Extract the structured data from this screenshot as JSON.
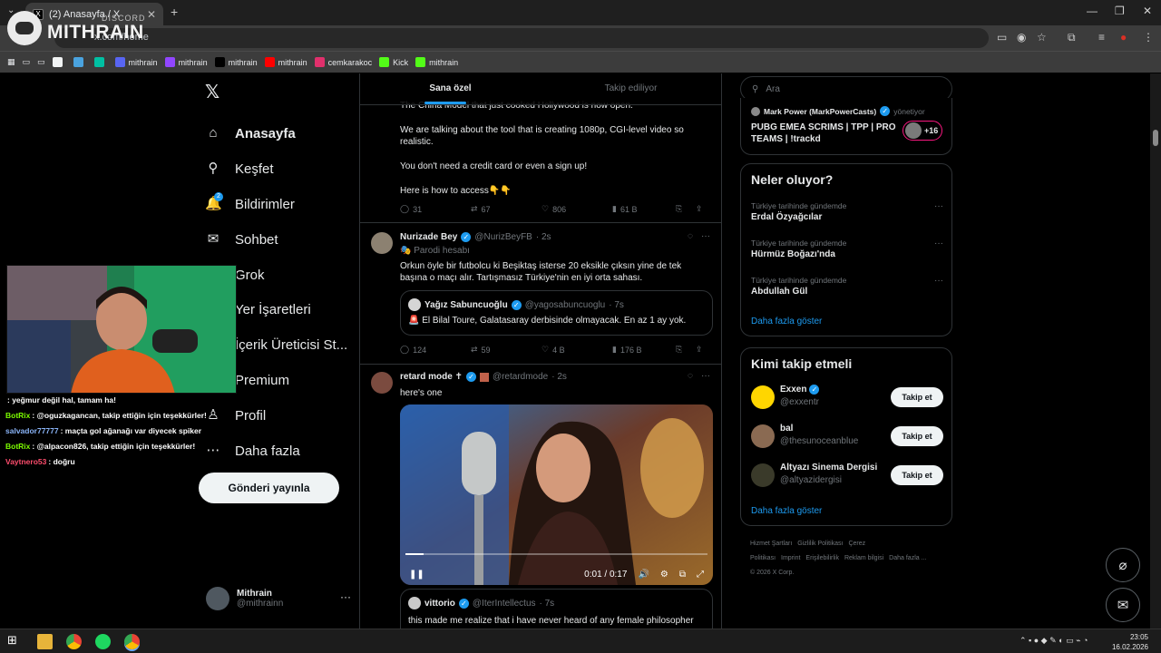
{
  "browser": {
    "tab_title": "(2) Anasayfa / X",
    "tab_close": "✕",
    "new_tab": "+",
    "url": "x.com/home"
  },
  "bookmarks": [
    {
      "label": "",
      "color": "#f1f3f4"
    },
    {
      "label": "",
      "color": "#4aa3df"
    },
    {
      "label": "",
      "color": "#00c0a3"
    },
    {
      "label": "mithrain",
      "color": "#5865f2"
    },
    {
      "label": "mithrain",
      "color": "#9146ff"
    },
    {
      "label": "mithrain",
      "color": "#000000"
    },
    {
      "label": "mithrain",
      "color": "#ff0000"
    },
    {
      "label": "cemkarakoc",
      "color": "#e1306c"
    },
    {
      "label": "Kick",
      "color": "#53fc18"
    },
    {
      "label": "mithrain",
      "color": "#53fc18"
    }
  ],
  "discord": {
    "small": "DISCORD",
    "big": "MITHRAIN"
  },
  "nav": {
    "items": [
      {
        "label": "Anasayfa",
        "icon": "home-icon",
        "glyph": "⌂"
      },
      {
        "label": "Keşfet",
        "icon": "search-icon",
        "glyph": "⚲"
      },
      {
        "label": "Bildirimler",
        "icon": "bell-icon",
        "glyph": "🔔"
      },
      {
        "label": "Sohbet",
        "icon": "mail-icon",
        "glyph": "✉"
      },
      {
        "label": "Grok",
        "icon": "grok-icon",
        "glyph": "◌"
      },
      {
        "label": "Yer İşaretleri",
        "icon": "bookmark-icon",
        "glyph": "☐"
      },
      {
        "label": "İçerik Üreticisi St...",
        "icon": "creator-icon",
        "glyph": "⚡"
      },
      {
        "label": "Premium",
        "icon": "premium-icon",
        "glyph": "✕"
      },
      {
        "label": "Profil",
        "icon": "profile-icon",
        "glyph": "♙"
      },
      {
        "label": "Daha fazla",
        "icon": "more-icon",
        "glyph": "⋯"
      }
    ],
    "notif_count": "2",
    "post_button": "Gönderi yayınla",
    "account_name": "Mithrain",
    "account_handle": "@mithrainn"
  },
  "chat": [
    {
      "user": "",
      "msg": ": yeğmur değil hal, tamam ha!",
      "color": "#ff5f9e"
    },
    {
      "user": "BotRix",
      "msg": ": @oguzkagancan, takip ettiğin için teşekkürler!",
      "color": "#7cfc00"
    },
    {
      "user": "salvador77777",
      "msg": ": maçta gol ağanağı var diyecek spiker",
      "color": "#8ab4f8"
    },
    {
      "user": "BotRix",
      "msg": ": @alpacon826, takip ettiğin için teşekkürler!",
      "color": "#7cfc00"
    },
    {
      "user": "Vaytnero53",
      "msg": ": doğru",
      "color": "#ff4d6d"
    }
  ],
  "timeline": {
    "tab_foryou": "Sana özel",
    "tab_following": "Takip ediliyor",
    "post1": {
      "lines": [
        "The China Model that just cooked Hollywood is now open.",
        "We are talking about the tool that is creating 1080p, CGI-level video so realistic.",
        "You don't need a credit card or even a sign up!",
        "Here is how to access👇👇"
      ],
      "replies": "31",
      "reposts": "67",
      "likes": "806",
      "views": "61 B"
    },
    "post2": {
      "name": "Nurizade Bey",
      "handle": "@NurizBeyFB",
      "time": "· 2s",
      "label": "Parodi hesabı",
      "text": "Orkun öyle bir futbolcu ki Beşiktaş isterse 20 eksikle çıksın yine de tek başına o maçı alır. Tartışmasız Türkiye'nin en iyi orta sahası.",
      "quote_name": "Yağız Sabuncuoğlu",
      "quote_handle": "@yagosabuncuoglu",
      "quote_time": "· 7s",
      "quote_text": "🚨 El Bilal Toure, Galatasaray derbisinde olmayacak. En az 1 ay yok.",
      "replies": "124",
      "reposts": "59",
      "likes": "4 B",
      "views": "176 B"
    },
    "post3": {
      "name": "retard mode ✝",
      "handle": "@retardmode",
      "time": "· 2s",
      "text": "here's one",
      "video_time": "0:01 / 0:17",
      "video_progress": 0.06,
      "quote_name": "vittorio",
      "quote_handle": "@IterIntellectus",
      "quote_time": "· 7s",
      "quote_text": "this made me realize that i have never heard of any female philosopher"
    }
  },
  "right": {
    "search_placeholder": "Ara",
    "community": {
      "owner": "Mark Power (MarkPowerCasts)",
      "owner_role": "yönetiyor",
      "title": "PUBG EMEA SCRIMS | TPP | PRO TEAMS | !trackd",
      "members_more": "+16"
    },
    "trends_title": "Neler oluyor?",
    "trends": [
      {
        "ctx": "Türkiye tarihinde gündemde",
        "topic": "Erdal Özyağcılar"
      },
      {
        "ctx": "Türkiye tarihinde gündemde",
        "topic": "Hürmüz Boğazı'nda"
      },
      {
        "ctx": "Türkiye tarihinde gündemde",
        "topic": "Abdullah Gül"
      }
    ],
    "show_more": "Daha fazla göster",
    "wtf_title": "Kimi takip etmeli",
    "wtf": [
      {
        "name": "Exxen",
        "handle": "@exxentr",
        "verified": true,
        "color": "#ffd600"
      },
      {
        "name": "bal",
        "handle": "@thesunoceanblue",
        "verified": false,
        "color": "#8a6a52"
      },
      {
        "name": "Altyazı Sinema Dergisi",
        "handle": "@altyazidergisi",
        "verified": false,
        "color": "#3a3a2a"
      }
    ],
    "follow_label": "Takip et",
    "footer": [
      "Hizmet Şartları",
      "Gizlilik Politikası",
      "Çerez Politikası",
      "Imprint",
      "Erişilebilirlik",
      "Reklam bilgisi",
      "Daha fazla ...",
      "© 2026 X Corp."
    ]
  },
  "taskbar": {
    "time": "23:05",
    "date": "16.02.2026"
  }
}
